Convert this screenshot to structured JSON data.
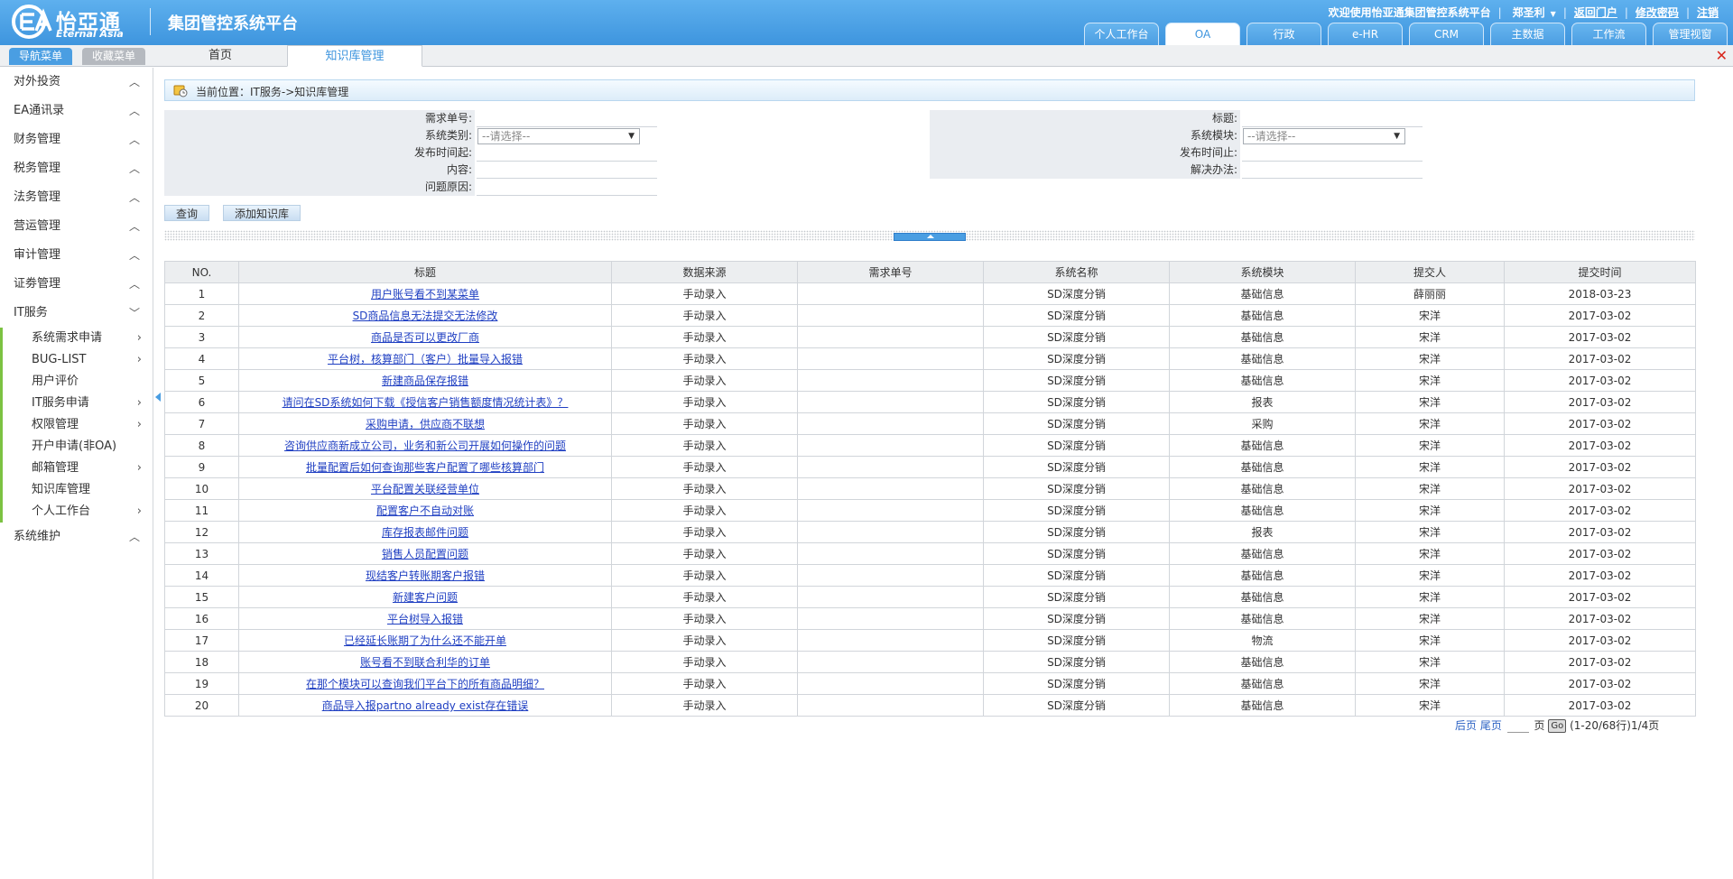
{
  "header": {
    "logo_cn": "怡亞通",
    "logo_en": "Eternal Asia",
    "platform_title": "集团管控系统平台",
    "welcome_text": "欢迎使用怡亚通集团管控系统平台",
    "user_name": "郑圣利",
    "back_portal": "返回门户",
    "change_password": "修改密码",
    "logout": "注销",
    "tabs": [
      "个人工作台",
      "OA",
      "行政",
      "e-HR",
      "CRM",
      "主数据",
      "工作流",
      "管理视窗"
    ]
  },
  "subbar": {
    "nav_menu": "导航菜单",
    "fav_menu": "收藏菜单",
    "home_tab": "首页",
    "current_tab": "知识库管理"
  },
  "sidebar": {
    "items": [
      {
        "label": "对外投资",
        "open": false
      },
      {
        "label": "EA通讯录",
        "open": false
      },
      {
        "label": "财务管理",
        "open": false
      },
      {
        "label": "税务管理",
        "open": false
      },
      {
        "label": "法务管理",
        "open": false
      },
      {
        "label": "营运管理",
        "open": false
      },
      {
        "label": "审计管理",
        "open": false
      },
      {
        "label": "证劵管理",
        "open": false
      },
      {
        "label": "IT服务",
        "open": true
      }
    ],
    "it_submenu": [
      {
        "label": "系统需求申请",
        "has_children": true
      },
      {
        "label": "BUG-LIST",
        "has_children": true
      },
      {
        "label": "用户评价",
        "has_children": false
      },
      {
        "label": "IT服务申请",
        "has_children": true
      },
      {
        "label": "权限管理",
        "has_children": true
      },
      {
        "label": "开户申请(非OA)",
        "has_children": false
      },
      {
        "label": "邮箱管理",
        "has_children": true
      },
      {
        "label": "知识库管理",
        "has_children": false
      },
      {
        "label": "个人工作台",
        "has_children": true
      }
    ],
    "last_item": "系统维护"
  },
  "breadcrumb": "当前位置：IT服务->知识库管理",
  "form": {
    "demand_no": "需求单号:",
    "title": "标题:",
    "sys_category": "系统类别:",
    "sys_module": "系统模块:",
    "publish_from": "发布时间起:",
    "publish_to": "发布时间止:",
    "content": "内容:",
    "solution": "解决办法:",
    "cause": "问题原因:",
    "select_placeholder": "--请选择--"
  },
  "buttons": {
    "query": "查询",
    "add_kb": "添加知识库"
  },
  "table": {
    "headers": [
      "NO.",
      "标题",
      "数据来源",
      "需求单号",
      "系统名称",
      "系统模块",
      "提交人",
      "提交时间"
    ],
    "rows": [
      [
        "1",
        "用户账号看不到某菜单",
        "手动录入",
        "",
        "SD深度分销",
        "基础信息",
        "薛丽丽",
        "2018-03-23"
      ],
      [
        "2",
        "SD商品信息无法提交无法修改",
        "手动录入",
        "",
        "SD深度分销",
        "基础信息",
        "宋洋",
        "2017-03-02"
      ],
      [
        "3",
        "商品是否可以更改厂商",
        "手动录入",
        "",
        "SD深度分销",
        "基础信息",
        "宋洋",
        "2017-03-02"
      ],
      [
        "4",
        "平台树，核算部门（客户）批量导入报错",
        "手动录入",
        "",
        "SD深度分销",
        "基础信息",
        "宋洋",
        "2017-03-02"
      ],
      [
        "5",
        "新建商品保存报错",
        "手动录入",
        "",
        "SD深度分销",
        "基础信息",
        "宋洋",
        "2017-03-02"
      ],
      [
        "6",
        "请问在SD系统如何下载《授信客户销售额度情况统计表》？",
        "手动录入",
        "",
        "SD深度分销",
        "报表",
        "宋洋",
        "2017-03-02"
      ],
      [
        "7",
        "采购申请，供应商不联想",
        "手动录入",
        "",
        "SD深度分销",
        "采购",
        "宋洋",
        "2017-03-02"
      ],
      [
        "8",
        "咨询供应商新成立公司，业务和新公司开展如何操作的问题",
        "手动录入",
        "",
        "SD深度分销",
        "基础信息",
        "宋洋",
        "2017-03-02"
      ],
      [
        "9",
        "批量配置后如何查询那些客户配置了哪些核算部门",
        "手动录入",
        "",
        "SD深度分销",
        "基础信息",
        "宋洋",
        "2017-03-02"
      ],
      [
        "10",
        "平台配置关联经营单位",
        "手动录入",
        "",
        "SD深度分销",
        "基础信息",
        "宋洋",
        "2017-03-02"
      ],
      [
        "11",
        "配置客户不自动对账",
        "手动录入",
        "",
        "SD深度分销",
        "基础信息",
        "宋洋",
        "2017-03-02"
      ],
      [
        "12",
        "库存报表邮件问题",
        "手动录入",
        "",
        "SD深度分销",
        "报表",
        "宋洋",
        "2017-03-02"
      ],
      [
        "13",
        "销售人员配置问题",
        "手动录入",
        "",
        "SD深度分销",
        "基础信息",
        "宋洋",
        "2017-03-02"
      ],
      [
        "14",
        "现结客户转账期客户报错",
        "手动录入",
        "",
        "SD深度分销",
        "基础信息",
        "宋洋",
        "2017-03-02"
      ],
      [
        "15",
        "新建客户问题",
        "手动录入",
        "",
        "SD深度分销",
        "基础信息",
        "宋洋",
        "2017-03-02"
      ],
      [
        "16",
        "平台树导入报错",
        "手动录入",
        "",
        "SD深度分销",
        "基础信息",
        "宋洋",
        "2017-03-02"
      ],
      [
        "17",
        "已经延长账期了为什么还不能开单",
        "手动录入",
        "",
        "SD深度分销",
        "物流",
        "宋洋",
        "2017-03-02"
      ],
      [
        "18",
        "账号看不到联合利华的订单",
        "手动录入",
        "",
        "SD深度分销",
        "基础信息",
        "宋洋",
        "2017-03-02"
      ],
      [
        "19",
        "在那个模块可以查询我们平台下的所有商品明细？",
        "手动录入",
        "",
        "SD深度分销",
        "基础信息",
        "宋洋",
        "2017-03-02"
      ],
      [
        "20",
        "商品导入报partno already exist存在错误",
        "手动录入",
        "",
        "SD深度分销",
        "基础信息",
        "宋洋",
        "2017-03-02"
      ]
    ]
  },
  "pager": {
    "prev": "后页",
    "last": "尾页",
    "page_unit": "页",
    "go": "Go",
    "summary": "(1-20/68行)1/4页"
  },
  "colors": {
    "header_blue": "#3e95de",
    "link_blue": "#1f3fc2",
    "sidebar_accent": "#7cc242",
    "close_red": "#d9261c"
  }
}
